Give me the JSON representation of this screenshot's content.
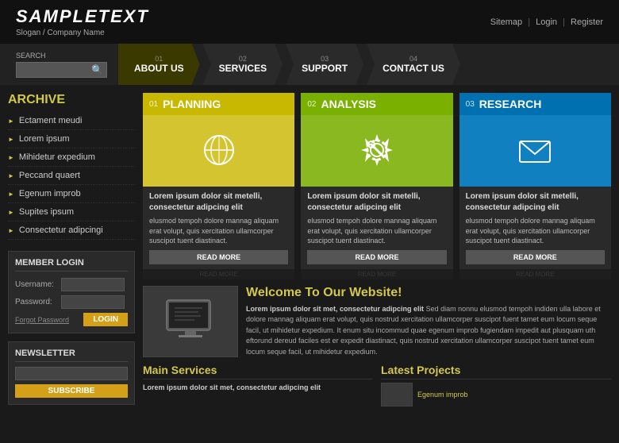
{
  "header": {
    "logo": "SAMPLETEXT",
    "slogan": "Slogan / Company Name",
    "top_links": [
      "Sitemap",
      "Login",
      "Register"
    ]
  },
  "nav": {
    "search_label": "SEARCH",
    "search_placeholder": "",
    "items": [
      {
        "label": "ABOUT US",
        "num": "01",
        "active": true
      },
      {
        "label": "SERVICES",
        "num": "02",
        "active": false
      },
      {
        "label": "SUPPORT",
        "num": "03",
        "active": false
      },
      {
        "label": "CONTACT US",
        "num": "04",
        "active": false
      }
    ]
  },
  "sidebar": {
    "archive_title": "ARCHIVE",
    "menu_items": [
      "Ectament meudi",
      "Lorem ipsum",
      "Mihidetur expedium",
      "Peccand quaert",
      "Egenum improb",
      "Supites ipsum",
      "Consectetur adipcingi"
    ]
  },
  "login": {
    "title": "MEMBER LOGIN",
    "username_label": "Username:",
    "password_label": "Password:",
    "forgot_label": "Forgot Password",
    "login_btn": "LOGIN"
  },
  "newsletter": {
    "title": "NEWSLETTER",
    "subscribe_btn": "SUBSCRIBE"
  },
  "cards": [
    {
      "num": "01",
      "title": "PLANNING",
      "color": "yellow",
      "body_title": "Lorem ipsum dolor sit metelli, consectetur adipcing elit",
      "body_text": "elusmod tempoh dolore mannag aliquam erat volupt, quis xercitation ullamcorper suscipot tuent diastinact.",
      "read_more": "READ MORE",
      "reflection": "READ MORE"
    },
    {
      "num": "02",
      "title": "ANALYSIS",
      "color": "green",
      "body_title": "Lorem ipsum dolor sit metelli, consectetur adipcing elit",
      "body_text": "elusmod tempoh dolore mannag aliquam erat volupt, quis xercitation ullamcorper suscipot tuent diastinact.",
      "read_more": "READ MORE",
      "reflection": "READ MORE"
    },
    {
      "num": "03",
      "title": "RESEARCH",
      "color": "blue",
      "body_title": "Lorem ipsum dolor sit metelli, consectetur adipcing elit",
      "body_text": "elusmod tempoh dolore mannag aliquam erat volupt, quis xercitation ullamcorper suscipot tuent diastinact.",
      "read_more": "READ MORE",
      "reflection": "READ MORE"
    }
  ],
  "welcome": {
    "title": "Welcome To Our Website!",
    "body_title": "Lorem ipsum dolor sit met, consectetur adipcing elit",
    "body_text": "Sed diam nonnu elusmod tempoh indiden ulla labore et dolore mannag aliquam erat volupt, quis nostrud xercitation ullamcorper suscipot fuent tamet eum locum seque facil, ut mihidetur expedium. It enum situ incommud quae egenum improb fugiendam impedit aut plusquam uth eftorund dereud faciles est er expedit diastinact, quis nostrud xercitation ullamcorper suscipot tuent tamet eum locum seque facil, ut mihidetur expedium."
  },
  "main_services": {
    "title": "Main Services",
    "body_title": "Lorem ipsum dolor sit met, consectetur adipcing elit",
    "body_text": ""
  },
  "latest_projects": {
    "title": "Latest Projects",
    "item_label": "Egenum improb"
  }
}
